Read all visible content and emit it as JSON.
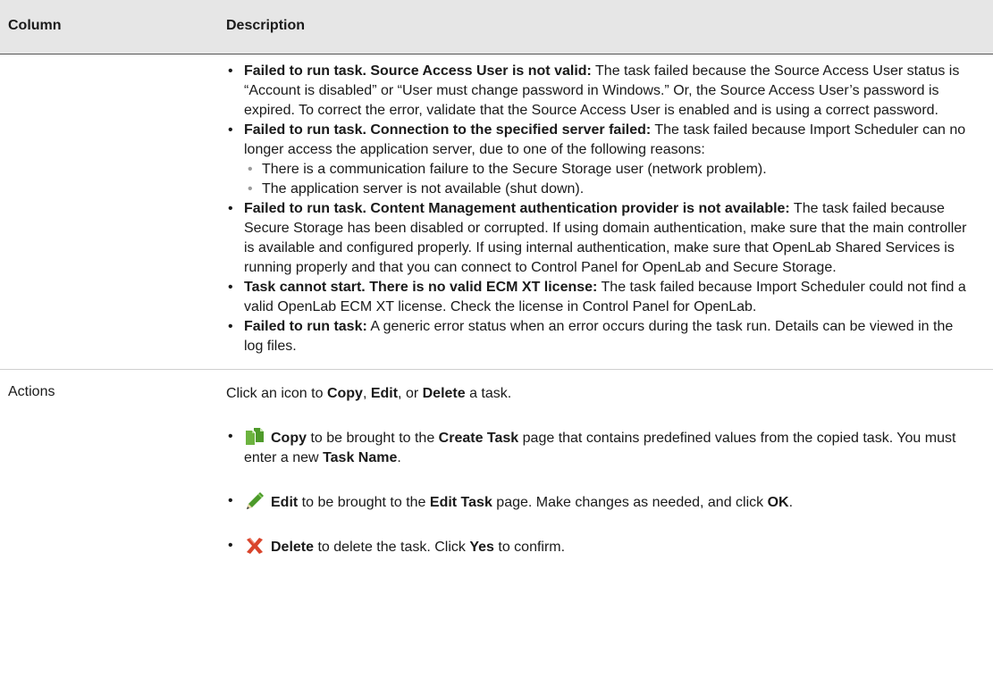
{
  "header": {
    "col_column": "Column",
    "col_description": "Description"
  },
  "status_row": {
    "items": [
      {
        "title": "Failed to run task. Source Access User is not valid:",
        "body": " The task failed because the Source Access User status is “Account is disabled” or “User must change password in Windows.” Or, the Source Access User’s password is expired. To correct the error, validate that the Source Access User is enabled and is using a correct password."
      },
      {
        "title": "Failed to run task. Connection to the specified server failed:",
        "body": " The task failed because Import Scheduler can no longer access the application server, due to one of the following reasons:",
        "sub": [
          "There is a communication failure to the Secure Storage user (network problem).",
          "The application server is not available (shut down)."
        ]
      },
      {
        "title": "Failed to run task. Content Management authentication provider is not available:",
        "body": " The task failed because Secure Storage has been disabled or corrupted. If using domain authentication, make sure that the main controller is available and configured properly. If using internal authen­tication, make sure that OpenLab Shared Services is running properly and that you can connect to Control Panel for OpenLab and Secure Storage."
      },
      {
        "title": "Task cannot start. There is no valid ECM XT license:",
        "body": " The task failed because Import Sched­uler could not find a valid OpenLab ECM XT license. Check the license in Control Panel for OpenLab."
      },
      {
        "title": "Failed to run task:",
        "body": " A generic error status when an error occurs during the task run. Details can be viewed in the log files."
      }
    ]
  },
  "actions_row": {
    "name": "Actions",
    "intro": {
      "p1": "Click an icon to ",
      "copy": "Copy",
      "p2": ", ",
      "edit": "Edit",
      "p3": ", or ",
      "delete": "Delete",
      "p4": " a task."
    },
    "copy_item": {
      "label": "Copy",
      "t1": " to be brought to the ",
      "page": "Create Task",
      "t2": " page that contains predefined values from the copied task. You must enter a new ",
      "field": "Task Name",
      "t3": "."
    },
    "edit_item": {
      "label": "Edit",
      "t1": " to be brought to the ",
      "page": "Edit Task",
      "t2": " page. Make changes as needed, and click ",
      "ok": "OK",
      "t3": "."
    },
    "delete_item": {
      "label": "Delete",
      "t1": " to delete the task. Click ",
      "yes": "Yes",
      "t2": " to confirm."
    },
    "icons": {
      "copy": "copy-icon",
      "edit": "pencil-icon",
      "delete": "x-icon"
    },
    "colors": {
      "copy_green": "#6cb33f",
      "pencil_green": "#4c9a2a",
      "delete_red": "#d9442b"
    }
  }
}
